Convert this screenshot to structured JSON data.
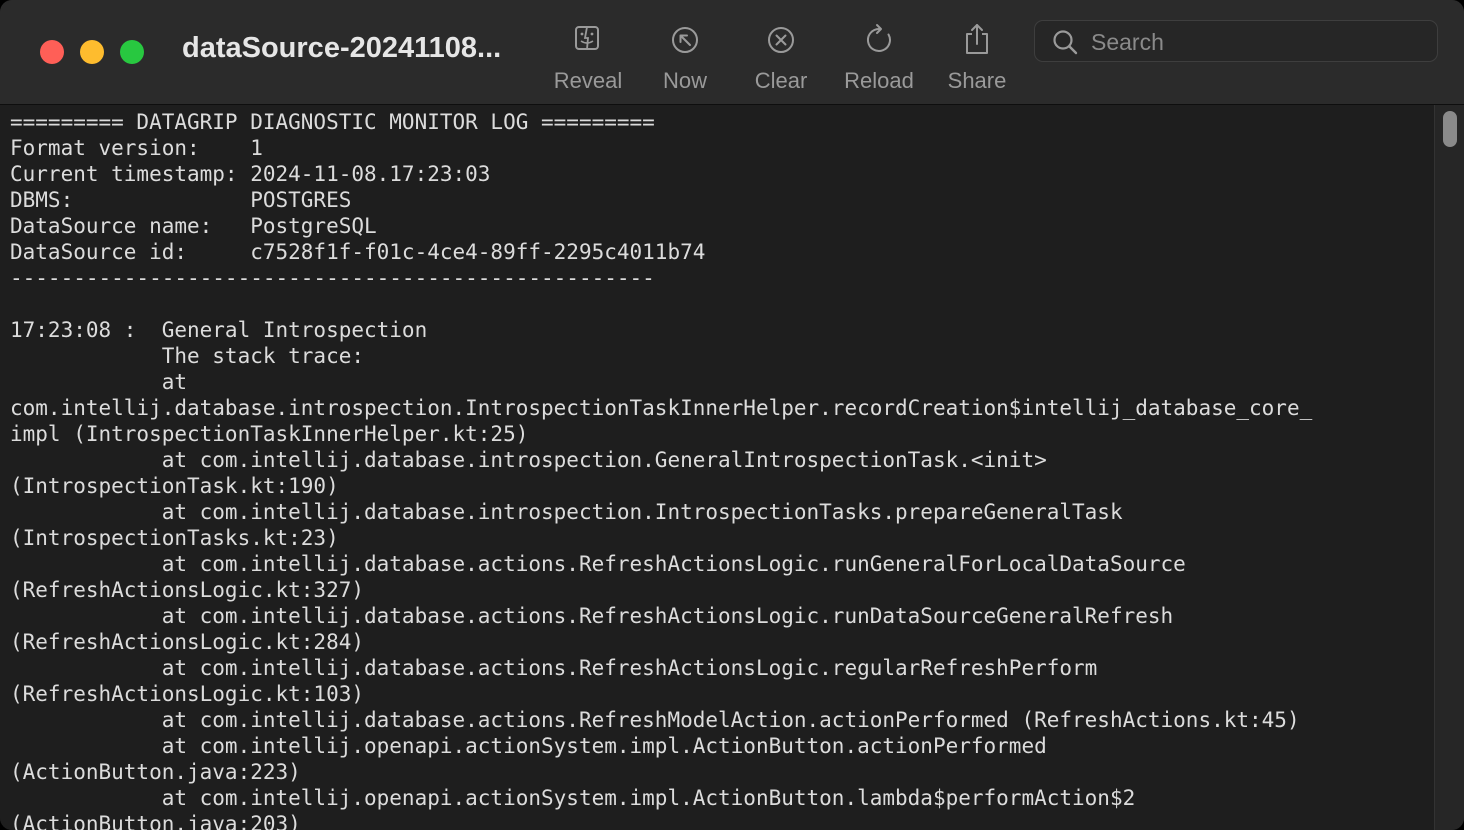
{
  "window": {
    "title": "dataSource-20241108..."
  },
  "toolbar": {
    "reveal_label": "Reveal",
    "now_label": "Now",
    "clear_label": "Clear",
    "reload_label": "Reload",
    "share_label": "Share"
  },
  "search": {
    "placeholder": "Search",
    "value": ""
  },
  "log": {
    "lines": [
      "========= DATAGRIP DIAGNOSTIC MONITOR LOG =========",
      "Format version:    1",
      "Current timestamp: 2024-11-08.17:23:03",
      "DBMS:              POSTGRES",
      "DataSource name:   PostgreSQL",
      "DataSource id:     c7528f1f-f01c-4ce4-89ff-2295c4011b74",
      "---------------------------------------------------",
      "",
      "17:23:08 :  General Introspection",
      "            The stack trace:",
      "            at",
      "com.intellij.database.introspection.IntrospectionTaskInnerHelper.recordCreation$intellij_database_core_",
      "impl (IntrospectionTaskInnerHelper.kt:25)",
      "            at com.intellij.database.introspection.GeneralIntrospectionTask.<init>",
      "(IntrospectionTask.kt:190)",
      "            at com.intellij.database.introspection.IntrospectionTasks.prepareGeneralTask",
      "(IntrospectionTasks.kt:23)",
      "            at com.intellij.database.actions.RefreshActionsLogic.runGeneralForLocalDataSource",
      "(RefreshActionsLogic.kt:327)",
      "            at com.intellij.database.actions.RefreshActionsLogic.runDataSourceGeneralRefresh",
      "(RefreshActionsLogic.kt:284)",
      "            at com.intellij.database.actions.RefreshActionsLogic.regularRefreshPerform",
      "(RefreshActionsLogic.kt:103)",
      "            at com.intellij.database.actions.RefreshModelAction.actionPerformed (RefreshActions.kt:45)",
      "            at com.intellij.openapi.actionSystem.impl.ActionButton.actionPerformed",
      "(ActionButton.java:223)",
      "            at com.intellij.openapi.actionSystem.impl.ActionButton.lambda$performAction$2",
      "(ActionButton.java:203)"
    ]
  }
}
